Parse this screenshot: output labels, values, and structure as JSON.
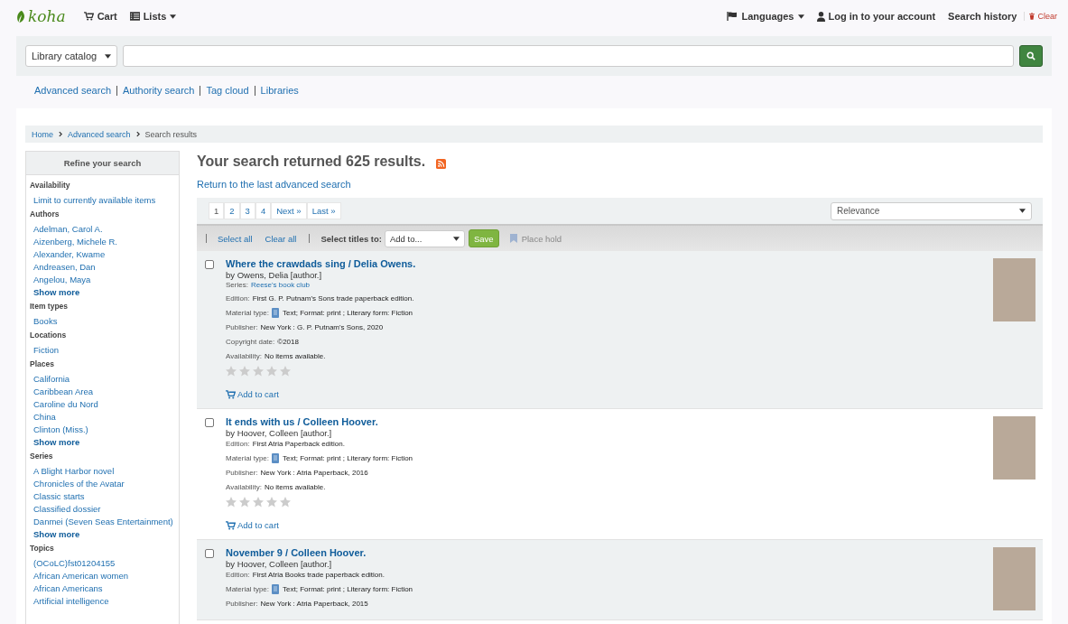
{
  "header": {
    "logo": "koha",
    "cart": "Cart",
    "lists": "Lists",
    "languages": "Languages",
    "login": "Log in to your account",
    "history": "Search history",
    "clear": "Clear"
  },
  "search": {
    "scope": "Library catalog"
  },
  "links": [
    "Advanced search",
    "Authority search",
    "Tag cloud",
    "Libraries"
  ],
  "breadcrumb": [
    {
      "label": "Home",
      "current": false
    },
    {
      "label": "Advanced search",
      "current": false
    },
    {
      "label": "Search results",
      "current": true
    }
  ],
  "sidebar": {
    "title": "Refine your search",
    "facets": [
      {
        "heading": "Availability",
        "items": [
          "Limit to currently available items"
        ]
      },
      {
        "heading": "Authors",
        "items": [
          "Adelman, Carol A.",
          "Aizenberg, Michele R.",
          "Alexander, Kwame",
          "Andreasen, Dan",
          "Angelou, Maya"
        ],
        "show_more": "Show more"
      },
      {
        "heading": "Item types",
        "items": [
          "Books"
        ]
      },
      {
        "heading": "Locations",
        "items": [
          "Fiction"
        ]
      },
      {
        "heading": "Places",
        "items": [
          "California",
          "Caribbean Area",
          "Caroline du Nord",
          "China",
          "Clinton (Miss.)"
        ],
        "show_more": "Show more"
      },
      {
        "heading": "Series",
        "items": [
          "A Blight Harbor novel",
          "Chronicles of the Avatar",
          "Classic starts",
          "Classified dossier",
          "Danmei (Seven Seas Entertainment)"
        ],
        "show_more": "Show more"
      },
      {
        "heading": "Topics",
        "items": [
          "(OCoLC)fst01204155",
          "African American women",
          "African Americans",
          "Artificial intelligence"
        ]
      }
    ]
  },
  "results_heading": "Your search returned 625 results.",
  "return_link": "Return to the last advanced search",
  "pagination": {
    "pages": [
      {
        "label": "1",
        "selected": true
      },
      {
        "label": "2",
        "selected": false
      },
      {
        "label": "3",
        "selected": false
      },
      {
        "label": "4",
        "selected": false
      }
    ],
    "next": "Next »",
    "last": "Last »"
  },
  "sort": "Relevance",
  "toolbar": {
    "select_all": "Select all",
    "clear_all": "Clear all",
    "select_label": "Select titles to:",
    "add_to": "Add to...",
    "save": "Save",
    "place_hold": {
      "label": "Place hold",
      "disabled": true
    }
  },
  "results": [
    {
      "checked": false,
      "title": "Where the crawdads sing / Delia Owens.",
      "author": "by Owens, Delia [author.]",
      "series": {
        "label": "Series:",
        "value": "Reese's book club"
      },
      "details": [
        {
          "kind": "plain",
          "label": "Edition:",
          "value": "First G. P. Putnam's Sons trade paperback edition."
        },
        {
          "kind": "material",
          "label": "Material type:",
          "value": "Text; Format: print ; Literary form: Fiction"
        },
        {
          "kind": "plain",
          "label": "Publisher:",
          "value": "New York : G. P. Putnam's Sons, 2020"
        },
        {
          "kind": "plain",
          "label": "Copyright date:",
          "value": "©2018"
        },
        {
          "kind": "plain",
          "label": "Availability:",
          "value": "No items available."
        }
      ],
      "stars": 0,
      "add_to_cart": "Add to cart"
    },
    {
      "checked": false,
      "title": "It ends with us / Colleen Hoover.",
      "author": "by Hoover, Colleen [author.]",
      "details": [
        {
          "kind": "edition",
          "label": "Edition:",
          "value": "First Atria Paperback edition."
        },
        {
          "kind": "material",
          "label": "Material type:",
          "value": "Text; Format: print ; Literary form: Fiction"
        },
        {
          "kind": "plain",
          "label": "Publisher:",
          "value": "New York : Atria Paperback, 2016"
        },
        {
          "kind": "plain",
          "label": "Availability:",
          "value": "No items available."
        }
      ],
      "stars": 0,
      "add_to_cart": "Add to cart"
    },
    {
      "checked": false,
      "title": "November 9 / Colleen Hoover.",
      "author": "by Hoover, Colleen [author.]",
      "details": [
        {
          "kind": "edition",
          "label": "Edition:",
          "value": "First Atria Books trade paperback edition."
        },
        {
          "kind": "material",
          "label": "Material type:",
          "value": "Text; Format: print ; Literary form: Fiction"
        },
        {
          "kind": "plain",
          "label": "Publisher:",
          "value": "New York : Atria Paperback, 2015"
        }
      ]
    }
  ]
}
